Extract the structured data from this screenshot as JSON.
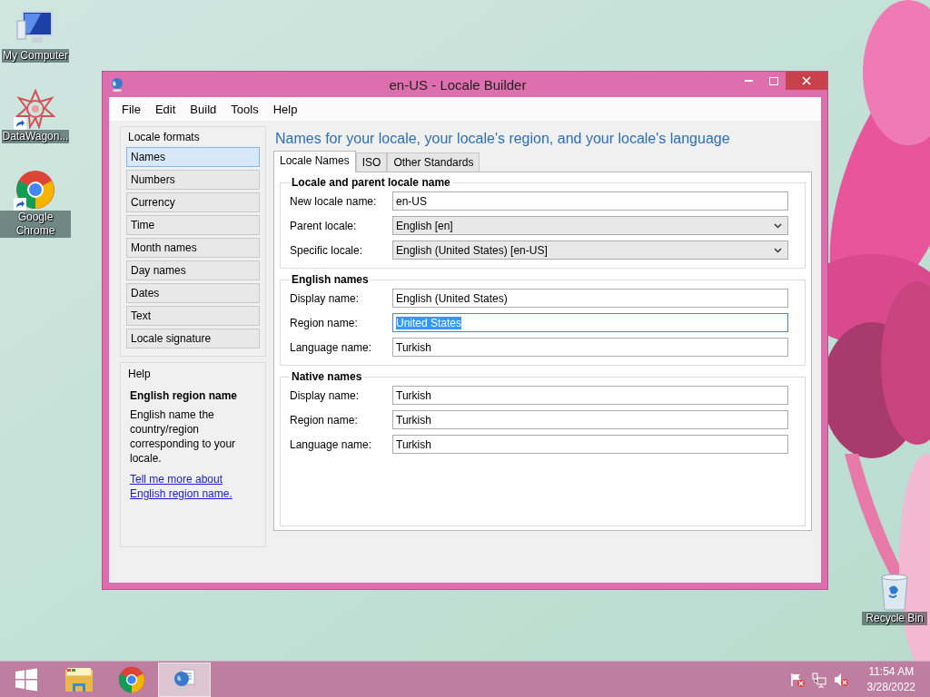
{
  "desktop_icons": [
    {
      "label": "My Computer",
      "kind": "computer",
      "shortcut": false
    },
    {
      "label": "DataWagon...",
      "kind": "star",
      "shortcut": true
    },
    {
      "label": "Google Chrome",
      "kind": "chrome",
      "shortcut": true
    }
  ],
  "recycle_bin": {
    "label": "Recycle Bin"
  },
  "window": {
    "title": "en-US - Locale Builder",
    "menu": [
      "File",
      "Edit",
      "Build",
      "Tools",
      "Help"
    ],
    "sidebar": {
      "title": "Locale formats",
      "items": [
        {
          "label": "Names",
          "selected": true
        },
        {
          "label": "Numbers",
          "selected": false
        },
        {
          "label": "Currency",
          "selected": false
        },
        {
          "label": "Time",
          "selected": false
        },
        {
          "label": "Month names",
          "selected": false
        },
        {
          "label": "Day names",
          "selected": false
        },
        {
          "label": "Dates",
          "selected": false
        },
        {
          "label": "Text",
          "selected": false
        },
        {
          "label": "Locale signature",
          "selected": false
        }
      ]
    },
    "help": {
      "title": "Help",
      "heading": "English region name",
      "text": "English name the country/region corresponding to your locale.",
      "link": "Tell me more about English region name."
    },
    "page_title": "Names for your locale, your locale's region, and your locale's language",
    "tabs": [
      {
        "label": "Locale Names",
        "selected": true
      },
      {
        "label": "ISO",
        "selected": false
      },
      {
        "label": "Other Standards",
        "selected": false
      }
    ],
    "groups": [
      {
        "title": "Locale and parent locale name",
        "fields": [
          {
            "label": "New locale name:",
            "kind": "text",
            "value": "en-US",
            "focused": false
          },
          {
            "label": "Parent locale:",
            "kind": "dropdown",
            "value": "English [en]",
            "focused": false
          },
          {
            "label": "Specific locale:",
            "kind": "dropdown",
            "value": "English (United States) [en-US]",
            "focused": false
          }
        ]
      },
      {
        "title": "English names",
        "fields": [
          {
            "label": "Display name:",
            "kind": "text",
            "value": "English (United States)",
            "focused": false
          },
          {
            "label": "Region name:",
            "kind": "text",
            "value": "United States",
            "focused": true
          },
          {
            "label": "Language name:",
            "kind": "text",
            "value": "Turkish",
            "focused": false
          }
        ]
      },
      {
        "title": "Native names",
        "fields": [
          {
            "label": "Display name:",
            "kind": "text",
            "value": "Turkish",
            "focused": false
          },
          {
            "label": "Region name:",
            "kind": "text",
            "value": "Turkish",
            "focused": false
          },
          {
            "label": "Language name:",
            "kind": "text",
            "value": "Turkish",
            "focused": false
          }
        ]
      }
    ]
  },
  "taskbar": {
    "items": [
      {
        "kind": "start",
        "active": false
      },
      {
        "kind": "explorer",
        "active": false
      },
      {
        "kind": "chrome",
        "active": false
      },
      {
        "kind": "locale-builder",
        "active": true
      }
    ],
    "tray": [
      {
        "kind": "flag"
      },
      {
        "kind": "network"
      },
      {
        "kind": "volume"
      }
    ],
    "time": "11:54 AM",
    "date": "3/28/2022"
  }
}
